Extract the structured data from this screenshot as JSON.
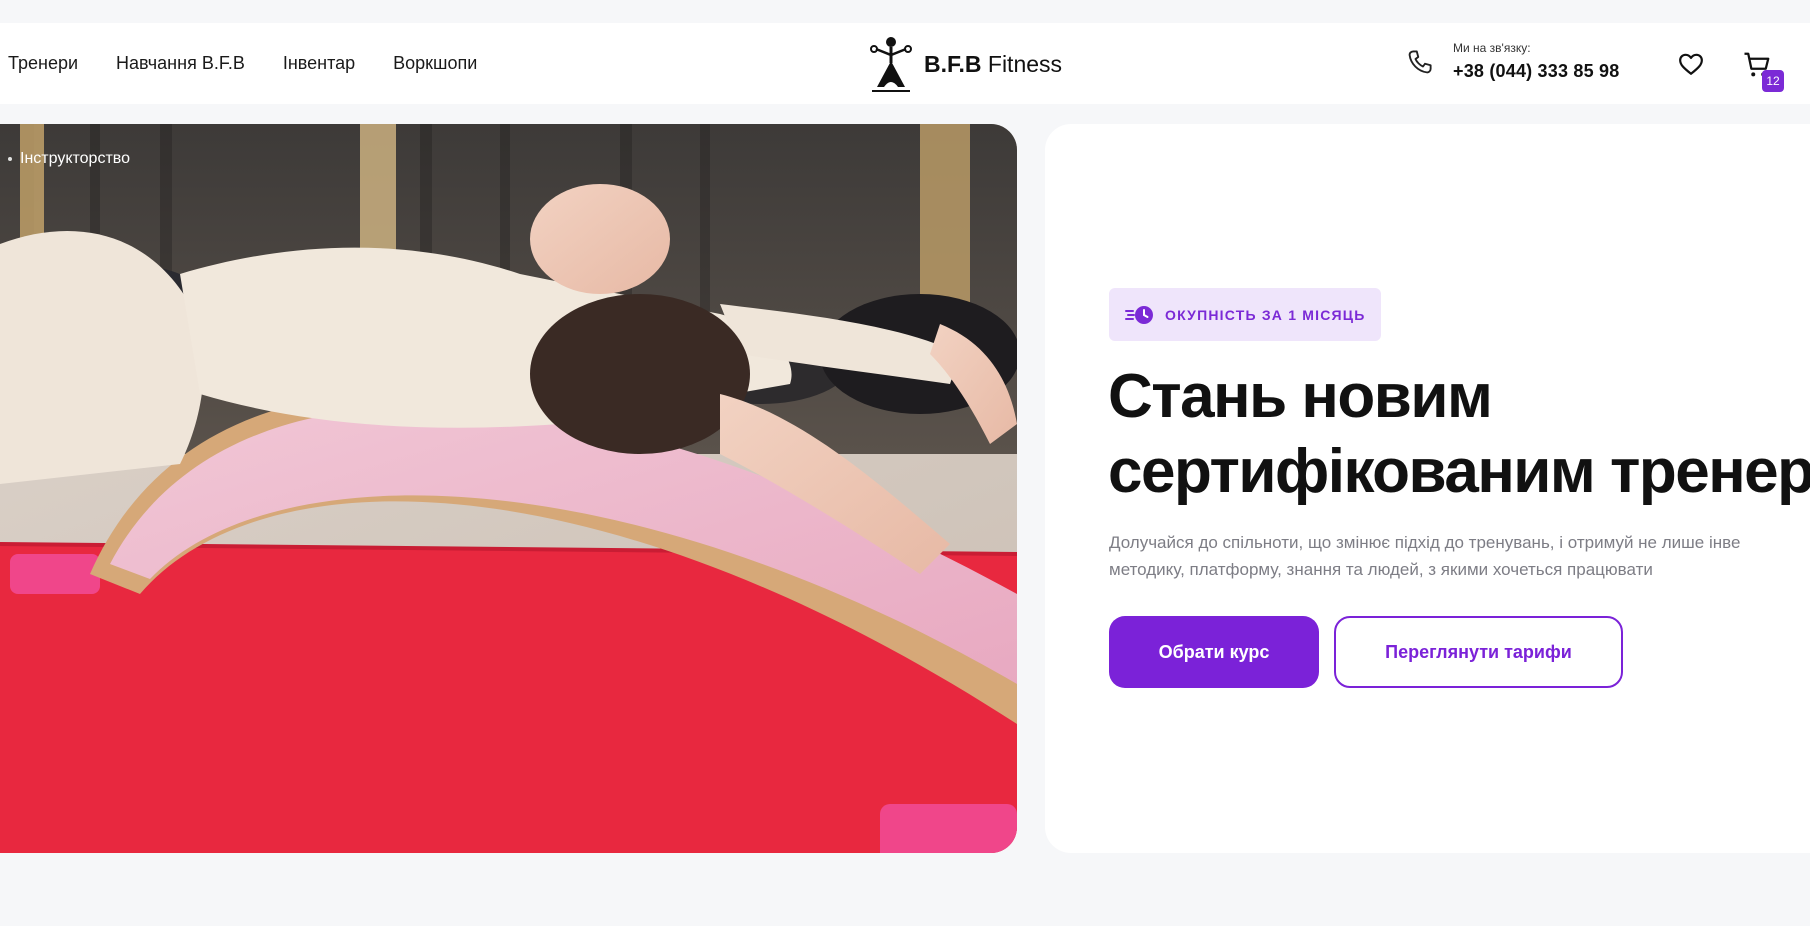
{
  "nav": {
    "items": [
      {
        "label": "Тренери"
      },
      {
        "label": "Навчання B.F.B"
      },
      {
        "label": "Інвентар"
      },
      {
        "label": "Воркшопи"
      }
    ]
  },
  "logo": {
    "brand": "B.F.B",
    "suffix": " Fitness"
  },
  "contact": {
    "caption": "Ми на зв'язку:",
    "phone": "+38 (044) 333 85 98"
  },
  "cart": {
    "count": "12"
  },
  "breadcrumb": {
    "current": "Інструкторство"
  },
  "hero": {
    "badge": "ОКУПНІСТЬ ЗА 1 МІСЯЦЬ",
    "title_line1": "Стань новим",
    "title_line2": "сертифікованим тренер",
    "subtitle_line1": "Долучайся до спільноти, що змінює підхід до тренувань, і отримуй не лише інве",
    "subtitle_line2": "методику, платформу, знання та людей,  з якими хочеться працювати",
    "primary_button": "Обрати курс",
    "secondary_button": "Переглянути тарифи"
  },
  "colors": {
    "accent": "#7b22d8",
    "badge_bg": "#efe5fb",
    "page_bg": "#f6f7f9"
  },
  "icons": [
    "phone-icon",
    "heart-icon",
    "cart-icon",
    "clock-speed-icon",
    "logo-figure-icon"
  ]
}
